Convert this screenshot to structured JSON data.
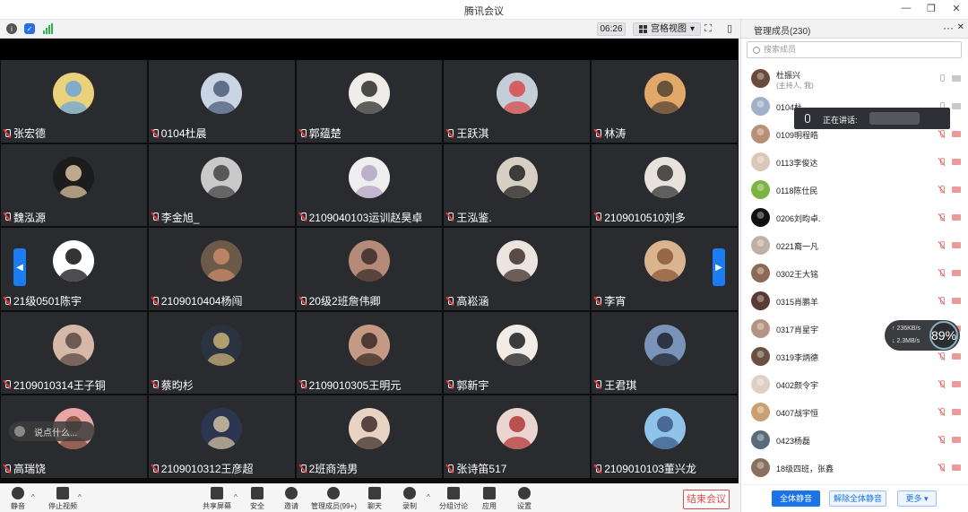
{
  "window": {
    "title": "腾讯会议"
  },
  "toolbar": {
    "timer": "06:26",
    "view_label": "宫格视图"
  },
  "tiles": [
    {
      "name": "张宏德",
      "color": "#e9d27a",
      "accent": "#6ea5d8"
    },
    {
      "name": "0104杜晨",
      "color": "#c9d5e4",
      "accent": "#4a5c7a"
    },
    {
      "name": "郭蕴楚",
      "color": "#f0ede8",
      "accent": "#2d2d2d"
    },
    {
      "name": "王跃淇",
      "color": "#c4ced9",
      "accent": "#d84a4a"
    },
    {
      "name": "林涛",
      "color": "#e2a86a",
      "accent": "#554433"
    },
    {
      "name": "魏泓源",
      "color": "#1c1c1c",
      "accent": "#d9c3a0"
    },
    {
      "name": "李金旭_",
      "color": "#c9c9c9",
      "accent": "#444444"
    },
    {
      "name": "2109040103运训赵昊卓",
      "color": "#eeeeee",
      "accent": "#b4a4c4"
    },
    {
      "name": "王泓鉴.",
      "color": "#d8cfc4",
      "accent": "#222222"
    },
    {
      "name": "2109010510刘多",
      "color": "#e8e2dc",
      "accent": "#333333"
    },
    {
      "name": "21级0501陈宇",
      "color": "#ffffff",
      "accent": "#111111"
    },
    {
      "name": "2109010404杨闯",
      "color": "#6b5a48",
      "accent": "#c98b6a"
    },
    {
      "name": "20级2班詹伟卿",
      "color": "#b58a78",
      "accent": "#3b2c2a"
    },
    {
      "name": "高崧涵",
      "color": "#ece4de",
      "accent": "#40302a"
    },
    {
      "name": "李宵",
      "color": "#d9b48f",
      "accent": "#8a5a3a"
    },
    {
      "name": "2109010314王子铜",
      "color": "#d6b8a8",
      "accent": "#5a4a44"
    },
    {
      "name": "蔡昀杉",
      "color": "#2a3340",
      "accent": "#c8b27a"
    },
    {
      "name": "2109010305王明元",
      "color": "#c59a84",
      "accent": "#3a2a24"
    },
    {
      "name": "郭新宇",
      "color": "#f2ebe6",
      "accent": "#1d1d1d"
    },
    {
      "name": "王君琪",
      "color": "#7a93b8",
      "accent": "#1f2530"
    },
    {
      "name": "高瑞饶",
      "color": "#e8a6a6",
      "accent": "#7a4a3a"
    },
    {
      "name": "2109010312王彦超",
      "color": "#2d3550",
      "accent": "#d0c0a0"
    },
    {
      "name": "2班商浩男",
      "color": "#e7d2c4",
      "accent": "#3d2d28"
    },
    {
      "name": "张诗笛517",
      "color": "#ead5d0",
      "accent": "#b23a3a"
    },
    {
      "name": "2109010103董兴龙",
      "color": "#8fc4e8",
      "accent": "#3d5a8a"
    }
  ],
  "chat_hint": "说点什么...",
  "bottom": {
    "mute": "静音",
    "stop_video": "停止视频",
    "share": "共享屏幕",
    "security": "安全",
    "invite": "邀请",
    "members": "管理成员(99+)",
    "chat": "聊天",
    "record": "录制",
    "breakout": "分组讨论",
    "apps": "应用",
    "settings": "设置",
    "end": "结束会议"
  },
  "panel": {
    "title": "管理成员(230)",
    "more_icon": "···",
    "search_placeholder": "搜索成员",
    "speaking_label": "正在讲话:",
    "members": [
      {
        "name": "杜振兴",
        "sub": "(主持人, 我)",
        "color": "#6a4a3a",
        "muted": false
      },
      {
        "name": "0104杜",
        "sub": "",
        "color": "#9fb1c8",
        "muted": false
      },
      {
        "name": "0109明程皓",
        "sub": "",
        "color": "#b89078",
        "muted": true
      },
      {
        "name": "0113李俊达",
        "sub": "",
        "color": "#d9c8b8",
        "muted": true
      },
      {
        "name": "0118陈仕民",
        "sub": "",
        "color": "#7cb342",
        "muted": true
      },
      {
        "name": "0206刘昀卓.",
        "sub": "",
        "color": "#111111",
        "muted": true
      },
      {
        "name": "0221裔一凡",
        "sub": "",
        "color": "#c0b0a4",
        "muted": true
      },
      {
        "name": "0302王大铭",
        "sub": "",
        "color": "#8a6a54",
        "muted": true
      },
      {
        "name": "0315肖鹏羊",
        "sub": "",
        "color": "#5a3a34",
        "muted": true
      },
      {
        "name": "0317肖星宇",
        "sub": "",
        "color": "#b49484",
        "muted": true
      },
      {
        "name": "0319李炳德",
        "sub": "",
        "color": "#6a5040",
        "muted": true
      },
      {
        "name": "0402颜令宇",
        "sub": "",
        "color": "#e0d0c4",
        "muted": true
      },
      {
        "name": "0407战宇恒",
        "sub": "",
        "color": "#c9a070",
        "muted": true
      },
      {
        "name": "0423杨磊",
        "sub": "",
        "color": "#5a6a7a",
        "muted": true
      },
      {
        "name": "18级四班，张鑫",
        "sub": "",
        "color": "#8a7060",
        "muted": true
      }
    ],
    "net": {
      "up": "↑ 236KB/s",
      "down": "↓ 2.3MB/s",
      "percent": "89%"
    },
    "mute_all": "全体静音",
    "unmute_all": "解除全体静音",
    "more": "更多 ▾"
  }
}
